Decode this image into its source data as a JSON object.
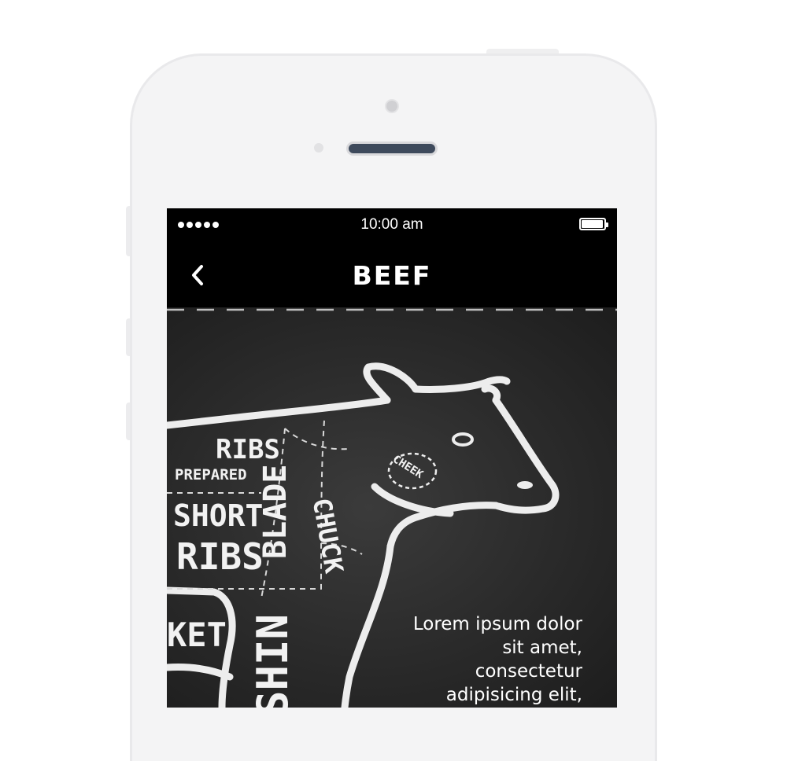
{
  "status_bar": {
    "signal_dots": 5,
    "time": "10:00 am",
    "battery_level": 0.95
  },
  "nav": {
    "back_icon": "chevron-left-icon",
    "title": "BEEF"
  },
  "cuts": {
    "ribs_prepared_1": "RIBS",
    "ribs_prepared_2": "PREPARED",
    "short_ribs_1": "SHORT",
    "short_ribs_2": "RIBS",
    "blade": "BLADE",
    "chuck": "CHUCK",
    "cheek": "CHEEK",
    "brisket": "KET",
    "shin": "SHIN"
  },
  "description": "Lorem ipsum dolor sit amet, consectetur adipisicing elit,",
  "colors": {
    "navbar": "#000000",
    "chalkboard": "#2b2b2b",
    "chalk": "#f2f2f2",
    "phone_body": "#f4f4f5"
  }
}
